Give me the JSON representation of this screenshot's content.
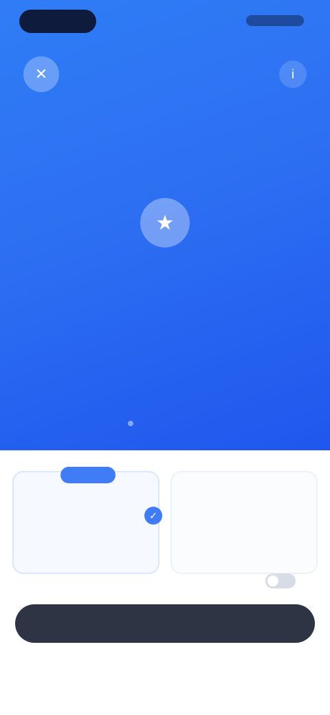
{
  "colors": {
    "hero_top": "#2f7df6",
    "hero_bottom": "#1f57ee",
    "accent": "#3f7cf5",
    "cta": "#2e3443"
  },
  "header": {
    "close_icon": "close-icon",
    "restore_icon": "info-icon",
    "close_glyph": "✕",
    "restore_glyph": "i"
  },
  "hero": {
    "icon_name": "star-icon",
    "icon_glyph": "★",
    "title": "",
    "subtitle": ""
  },
  "plans": [
    {
      "badge": "",
      "name": "",
      "price": "",
      "note": "",
      "selected": true
    },
    {
      "badge": "",
      "name": "",
      "price": "",
      "note": "",
      "selected": false
    }
  ],
  "selected_check_glyph": "✓",
  "trial": {
    "label": ""
  },
  "cta": {
    "label": ""
  },
  "footer": {
    "links": [
      "",
      "",
      ""
    ]
  }
}
